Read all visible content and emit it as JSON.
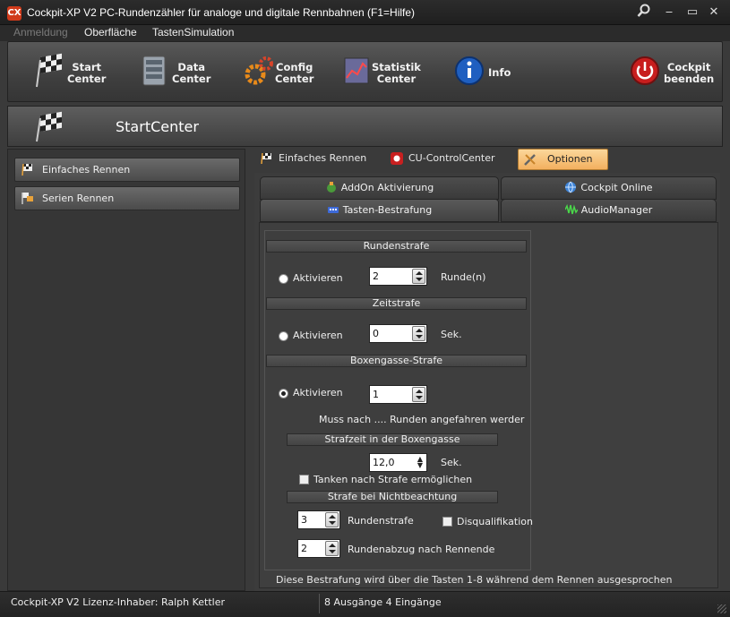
{
  "window": {
    "title": "Cockpit-XP V2 PC-Rundenzähler für analoge und digitale Rennbahnen (F1=Hilfe)",
    "app_icon": "CX"
  },
  "menu": {
    "anmeldung": "Anmeldung",
    "oberflaeche": "Oberfläche",
    "tastensimulation": "TastenSimulation"
  },
  "toolbar": {
    "start": "Start\nCenter",
    "data": "Data\nCenter",
    "config": "Config\nCenter",
    "statistik": "Statistik\nCenter",
    "info": "Info",
    "beenden": "Cockpit\nbeenden"
  },
  "section": {
    "title": "StartCenter"
  },
  "sidebar": {
    "items": [
      {
        "label": "Einfaches Rennen"
      },
      {
        "label": "Serien Rennen"
      }
    ]
  },
  "tabs": {
    "einfach": "Einfaches Rennen",
    "cu": "CU-ControlCenter",
    "optionen": "Optionen"
  },
  "subtabs": {
    "addon": "AddOn Aktivierung",
    "online": "Cockpit Online",
    "tasten": "Tasten-Bestrafung",
    "audio": "AudioManager"
  },
  "penalty": {
    "runden": {
      "header": "Rundenstrafe",
      "label": "Aktivieren",
      "value": "2",
      "unit": "Runde(n)",
      "checked": false
    },
    "zeit": {
      "header": "Zeitstrafe",
      "label": "Aktivieren",
      "value": "0",
      "unit": "Sek.",
      "checked": false
    },
    "boxen": {
      "header": "Boxengasse-Strafe",
      "label": "Aktivieren",
      "value": "1",
      "checked": true,
      "note": "Muss nach .... Runden angefahren werder"
    },
    "strafzeit": {
      "header": "Strafzeit in der Boxengasse",
      "value": "12,0",
      "unit": "Sek.",
      "tanken": "Tanken nach Strafe ermöglichen"
    },
    "nichtbeachtung": {
      "header": "Strafe bei Nichtbeachtung",
      "runden_value": "3",
      "runden_label": "Rundenstrafe",
      "disq": "Disqualifikation",
      "abzug_value": "2",
      "abzug_label": "Rundenabzug nach Rennende"
    },
    "footnote": "Diese Bestrafung wird über die Tasten 1-8 während dem Rennen ausgesprochen"
  },
  "status": {
    "left": "Cockpit-XP V2 Lizenz-Inhaber: Ralph Kettler",
    "right": "8 Ausgänge 4 Eingänge"
  }
}
